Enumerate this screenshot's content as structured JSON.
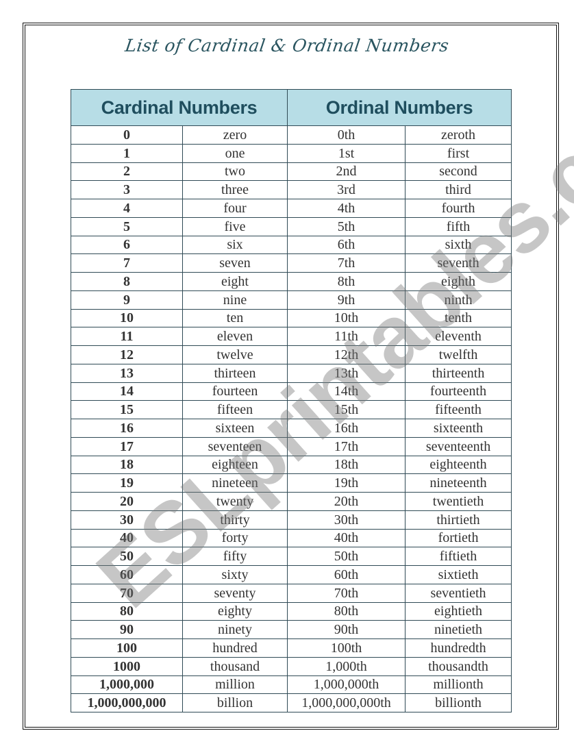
{
  "title": "List of Cardinal & Ordinal Numbers",
  "watermark": "ESLprintables.com",
  "headers": {
    "cardinal": "Cardinal Numbers",
    "ordinal": "Ordinal Numbers"
  },
  "colors": {
    "header_bg": "#b7dde6",
    "header_text": "#1f4e5e",
    "title_text": "#2a5560",
    "border": "#2f4a55"
  },
  "rows": [
    {
      "num": "0",
      "cardinal": "zero",
      "ord_num": "0th",
      "ordinal": "zeroth"
    },
    {
      "num": "1",
      "cardinal": "one",
      "ord_num": "1st",
      "ordinal": "first"
    },
    {
      "num": "2",
      "cardinal": "two",
      "ord_num": "2nd",
      "ordinal": "second"
    },
    {
      "num": "3",
      "cardinal": "three",
      "ord_num": "3rd",
      "ordinal": "third"
    },
    {
      "num": "4",
      "cardinal": "four",
      "ord_num": "4th",
      "ordinal": "fourth"
    },
    {
      "num": "5",
      "cardinal": "five",
      "ord_num": "5th",
      "ordinal": "fifth"
    },
    {
      "num": "6",
      "cardinal": "six",
      "ord_num": "6th",
      "ordinal": "sixth"
    },
    {
      "num": "7",
      "cardinal": "seven",
      "ord_num": "7th",
      "ordinal": "seventh"
    },
    {
      "num": "8",
      "cardinal": "eight",
      "ord_num": "8th",
      "ordinal": "eighth"
    },
    {
      "num": "9",
      "cardinal": "nine",
      "ord_num": "9th",
      "ordinal": "ninth"
    },
    {
      "num": "10",
      "cardinal": "ten",
      "ord_num": "10th",
      "ordinal": "tenth"
    },
    {
      "num": "11",
      "cardinal": "eleven",
      "ord_num": "11th",
      "ordinal": "eleventh"
    },
    {
      "num": "12",
      "cardinal": "twelve",
      "ord_num": "12th",
      "ordinal": "twelfth"
    },
    {
      "num": "13",
      "cardinal": "thirteen",
      "ord_num": "13th",
      "ordinal": "thirteenth"
    },
    {
      "num": "14",
      "cardinal": "fourteen",
      "ord_num": "14th",
      "ordinal": "fourteenth"
    },
    {
      "num": "15",
      "cardinal": "fifteen",
      "ord_num": "15th",
      "ordinal": "fifteenth"
    },
    {
      "num": "16",
      "cardinal": "sixteen",
      "ord_num": "16th",
      "ordinal": "sixteenth"
    },
    {
      "num": "17",
      "cardinal": "seventeen",
      "ord_num": "17th",
      "ordinal": "seventeenth"
    },
    {
      "num": "18",
      "cardinal": "eighteen",
      "ord_num": "18th",
      "ordinal": "eighteenth"
    },
    {
      "num": "19",
      "cardinal": "nineteen",
      "ord_num": "19th",
      "ordinal": "nineteenth"
    },
    {
      "num": "20",
      "cardinal": "twenty",
      "ord_num": "20th",
      "ordinal": "twentieth"
    },
    {
      "num": "30",
      "cardinal": "thirty",
      "ord_num": "30th",
      "ordinal": "thirtieth"
    },
    {
      "num": "40",
      "cardinal": "forty",
      "ord_num": "40th",
      "ordinal": "fortieth"
    },
    {
      "num": "50",
      "cardinal": "fifty",
      "ord_num": "50th",
      "ordinal": "fiftieth"
    },
    {
      "num": "60",
      "cardinal": "sixty",
      "ord_num": "60th",
      "ordinal": "sixtieth"
    },
    {
      "num": "70",
      "cardinal": "seventy",
      "ord_num": "70th",
      "ordinal": "seventieth"
    },
    {
      "num": "80",
      "cardinal": "eighty",
      "ord_num": "80th",
      "ordinal": "eightieth"
    },
    {
      "num": "90",
      "cardinal": "ninety",
      "ord_num": "90th",
      "ordinal": "ninetieth"
    },
    {
      "num": "100",
      "cardinal": "hundred",
      "ord_num": "100th",
      "ordinal": "hundredth"
    },
    {
      "num": "1000",
      "cardinal": "thousand",
      "ord_num": "1,000th",
      "ordinal": "thousandth"
    },
    {
      "num": "1,000,000",
      "cardinal": "million",
      "ord_num": "1,000,000th",
      "ordinal": "millionth"
    },
    {
      "num": "1,000,000,000",
      "cardinal": "billion",
      "ord_num": "1,000,000,000th",
      "ordinal": "billionth"
    }
  ]
}
